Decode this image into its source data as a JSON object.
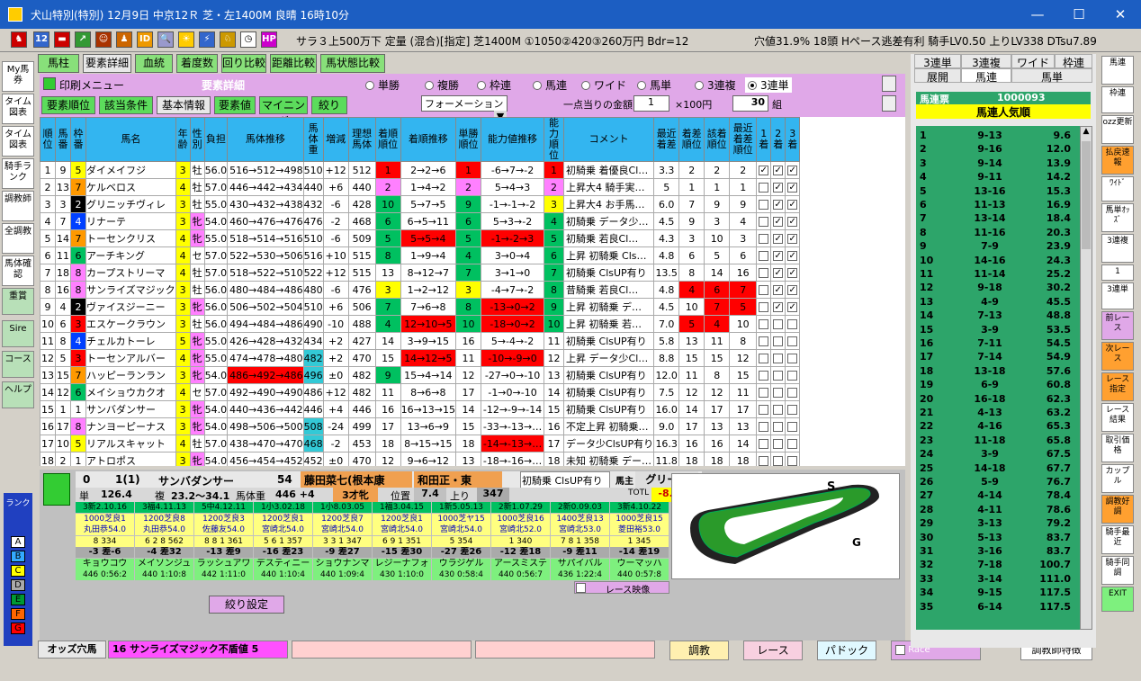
{
  "window": {
    "title": "犬山特別(特別)  12月9日  中京12Ｒ 芝・左1400M 良晴 16時10分",
    "min": "—",
    "max": "☐",
    "close": "✕"
  },
  "race_info": "サラ３上500万下 定量 (混合)[指定] 芝1400M ①1050②420③260万円 Bdr=12",
  "race_right": "穴値31.9% 18頭 Hペース逃差有利 騎手LV0.50 上りLV338 DTsu7.89",
  "left_nav": [
    "My馬券",
    "タイム図表",
    "タイム図表",
    "騎手ランク",
    "調教師",
    "全調教",
    "馬体確認",
    "重賞",
    "Sire",
    "コース",
    "ヘルプ"
  ],
  "rank": {
    "label": "ランク",
    "items": [
      "A",
      "B",
      "C",
      "D",
      "E",
      "F",
      "G"
    ]
  },
  "tabs": [
    "馬柱",
    "要素詳細",
    "血統",
    "着度数",
    "回り比較",
    "距離比較",
    "馬状態比較"
  ],
  "panel": {
    "print": "印刷メニュー",
    "title": "要素詳細",
    "btns": [
      "要素順位",
      "該当条件",
      "基本情報",
      "要素値",
      "マイニング",
      "絞り"
    ],
    "radios": [
      "単勝",
      "複勝",
      "枠連",
      "馬連",
      "ワイド",
      "馬単",
      "3連複",
      "3連単"
    ],
    "radio_selected": 7,
    "mode": "フォーメーション",
    "amount_label": "一点当りの金額",
    "amount": "1",
    "unit": "×100円",
    "count": "30",
    "count_unit": "組"
  },
  "headers": [
    "順位",
    "馬番",
    "枠番",
    "馬名",
    "年齢",
    "性別",
    "負担",
    "馬体推移",
    "馬体重",
    "増減",
    "理想馬体",
    "着順順位",
    "着順推移",
    "単勝順位",
    "能力値推移",
    "能力順位",
    "コメント",
    "最近着差",
    "着差順位",
    "該着順位",
    "最近着差順位",
    "1着",
    "2着",
    "3着"
  ],
  "rows": [
    [
      "1",
      "9",
      "5",
      "ダイメイフジ",
      "3",
      "牡",
      "56.0",
      "516→512→498",
      "510",
      "+12",
      "512",
      "1",
      "2→2→6",
      "1",
      "-6→7→-2",
      "1",
      "初騎乗 着優良Cl…",
      "3.3",
      "2",
      "2",
      "2",
      "✓",
      "✓",
      "✓"
    ],
    [
      "2",
      "13",
      "7",
      "ケルベロス",
      "4",
      "牡",
      "57.0",
      "446→442→434",
      "440",
      "+6",
      "440",
      "2",
      "1→4→2",
      "2",
      "5→4→3",
      "2",
      "上昇大4 騎手実…",
      "5",
      "1",
      "1",
      "1",
      "",
      "✓",
      "✓"
    ],
    [
      "3",
      "3",
      "2",
      "グリニッチヴィレ",
      "3",
      "牡",
      "55.0",
      "430→432→438",
      "432",
      "-6",
      "428",
      "10",
      "5→7→5",
      "9",
      "-1→-1→-2",
      "3",
      "上昇大4 お手馬…",
      "6.0",
      "7",
      "9",
      "9",
      "",
      "✓",
      "✓"
    ],
    [
      "4",
      "7",
      "4",
      "リナーテ",
      "3",
      "牝",
      "54.0",
      "460→476→476",
      "476",
      "-2",
      "468",
      "6",
      "6→5→11",
      "6",
      "5→3→-2",
      "4",
      "初騎乗 データ少…",
      "4.5",
      "9",
      "3",
      "4",
      "",
      "✓",
      "✓"
    ],
    [
      "5",
      "14",
      "7",
      "トーセンクリス",
      "4",
      "牝",
      "55.0",
      "518→514→516",
      "510",
      "-6",
      "509",
      "5",
      "5→5→4",
      "5",
      "-1→-2→3",
      "5",
      "初騎乗 若良Cl…",
      "4.3",
      "3",
      "10",
      "3",
      "",
      "✓",
      "✓"
    ],
    [
      "6",
      "11",
      "6",
      "アーチキング",
      "4",
      "セ",
      "57.0",
      "522→530→506",
      "516",
      "+10",
      "515",
      "8",
      "1→9→4",
      "4",
      "3→0→4",
      "6",
      "上昇 初騎乗 Cls…",
      "4.8",
      "6",
      "5",
      "6",
      "",
      "✓",
      "✓"
    ],
    [
      "7",
      "18",
      "8",
      "カープストリーマ",
      "4",
      "牡",
      "57.0",
      "518→522→510",
      "522",
      "+12",
      "515",
      "13",
      "8→12→7",
      "7",
      "3→1→0",
      "7",
      "初騎乗 ClsUP有り",
      "13.5",
      "8",
      "14",
      "16",
      "",
      "✓",
      "✓"
    ],
    [
      "8",
      "16",
      "8",
      "サンライズマジック",
      "3",
      "牡",
      "56.0",
      "480→484→486",
      "480",
      "-6",
      "476",
      "3",
      "1→2→12",
      "3",
      "-4→7→-2",
      "8",
      "昔騎乗 若良Cl…",
      "4.8",
      "4",
      "6",
      "7",
      "",
      "✓",
      "✓"
    ],
    [
      "9",
      "4",
      "2",
      "ヴァイスジーニー",
      "3",
      "牝",
      "56.0",
      "506→502→504",
      "510",
      "+6",
      "506",
      "7",
      "7→6→8",
      "8",
      "-13→0→2",
      "9",
      "上昇 初騎乗 デ…",
      "4.5",
      "10",
      "7",
      "5",
      "",
      "✓",
      "✓"
    ],
    [
      "10",
      "6",
      "3",
      "エスケークラウン",
      "3",
      "牡",
      "56.0",
      "494→484→486",
      "490",
      "-10",
      "488",
      "4",
      "12→10→5",
      "10",
      "-18→0→2",
      "10",
      "上昇 初騎乗 若…",
      "7.0",
      "5",
      "4",
      "10",
      "",
      "",
      ""
    ],
    [
      "11",
      "8",
      "4",
      "チェルカトーレ",
      "5",
      "牝",
      "55.0",
      "426→428→432",
      "434",
      "+2",
      "427",
      "14",
      "3→9→15",
      "16",
      "5→-4→-2",
      "11",
      "初騎乗 ClsUP有り",
      "5.8",
      "13",
      "11",
      "8",
      "",
      "",
      ""
    ],
    [
      "12",
      "5",
      "3",
      "トーセンアルバー",
      "4",
      "牝",
      "55.0",
      "474→478→480",
      "482",
      "+2",
      "470",
      "15",
      "14→12→5",
      "11",
      "-10→-9→0",
      "12",
      "上昇 データ少Cl…",
      "8.8",
      "15",
      "15",
      "12",
      "",
      "",
      ""
    ],
    [
      "13",
      "15",
      "7",
      "ハッピーランラン",
      "3",
      "牝",
      "54.0",
      "486→492→486",
      "496",
      "±0",
      "482",
      "9",
      "15→4→14",
      "12",
      "-27→0→-10",
      "13",
      "初騎乗 ClsUP有り",
      "12.0",
      "11",
      "8",
      "15",
      "",
      "",
      ""
    ],
    [
      "14",
      "12",
      "6",
      "メイショウカクオ",
      "4",
      "セ",
      "57.0",
      "492→490→490",
      "486",
      "+12",
      "482",
      "11",
      "8→6→8",
      "17",
      "-1→0→-10",
      "14",
      "初騎乗 ClsUP有り",
      "7.5",
      "12",
      "12",
      "11",
      "",
      "",
      ""
    ],
    [
      "15",
      "1",
      "1",
      "サンバダンサー",
      "3",
      "牝",
      "54.0",
      "440→436→442",
      "446",
      "+4",
      "446",
      "16",
      "16→13→15",
      "14",
      "-12→-9→-14",
      "15",
      "初騎乗 ClsUP有り",
      "16.0",
      "14",
      "17",
      "17",
      "",
      "",
      ""
    ],
    [
      "16",
      "17",
      "8",
      "ナンヨーピーナス",
      "3",
      "牝",
      "54.0",
      "498→506→500",
      "508",
      "-24",
      "499",
      "17",
      "13→6→9",
      "15",
      "-33→-13→…",
      "16",
      "不定上昇 初騎乗…",
      "9.0",
      "17",
      "13",
      "13",
      "",
      "",
      ""
    ],
    [
      "17",
      "10",
      "5",
      "リアルスキャット",
      "4",
      "牡",
      "57.0",
      "438→470→470",
      "468",
      "-2",
      "453",
      "18",
      "8→15→15",
      "18",
      "-14→-13→…",
      "17",
      "データ少ClsUP有り",
      "16.3",
      "16",
      "16",
      "14",
      "",
      "",
      ""
    ],
    [
      "18",
      "2",
      "1",
      "アトロポス",
      "3",
      "牝",
      "54.0",
      "456→454→452",
      "452",
      "±0",
      "470",
      "12",
      "9→6→12",
      "13",
      "-18→-16→…",
      "18",
      "未知 初騎乗 デー…",
      "11.8",
      "18",
      "18",
      "18",
      "",
      "",
      ""
    ]
  ],
  "detail": {
    "num": "0",
    "waku": "1(1)",
    "name": "サンバダンサー",
    "weight": "54",
    "jockey": "藤田菜七(根本康",
    "trainer": "和田正・東",
    "comment": "初騎乗 ClsUP有り",
    "owner_lbl": "馬主",
    "owner": "グリーン",
    "tan_lbl": "単",
    "tan": "126.4",
    "fuku_lbl": "複",
    "fuku": "23.2～34.1",
    "bw_lbl": "馬体重",
    "bw": "446 +4",
    "age": "3才牝",
    "pos_lbl": "位置",
    "pos": "7.4",
    "agari_lbl": "上り",
    "agari": "347",
    "totl_lbl": "TOTL",
    "totl": "-8.6 O",
    "past": [
      {
        "d": "3新2.10.16",
        "c": "1000芝良1",
        "j": "丸田恭54.0",
        "n": "8 334",
        "s": "-3 差-6",
        "h": "キョウコウ",
        "t": "446 0:56:2"
      },
      {
        "d": "3福4.11.13",
        "c": "1200芝良8",
        "j": "丸田恭54.0",
        "n": "6 2 8 562",
        "s": "-4 差32",
        "h": "メイソンジュ",
        "t": "440 1:10:8"
      },
      {
        "d": "5中4.12.11",
        "c": "1200芝良3",
        "j": "佐藤友54.0",
        "n": "8 8 1 361",
        "s": "-13 差9",
        "h": "ラッシュアワ",
        "t": "442 1:11:0"
      },
      {
        "d": "1小3.02.18",
        "c": "1200芝良1",
        "j": "宮崎北54.0",
        "n": "5 6 1 357",
        "s": "-16 差23",
        "h": "デスティニー",
        "t": "440 1:10:4"
      },
      {
        "d": "1小8.03.05",
        "c": "1200芝良7",
        "j": "宮崎北54.0",
        "n": "3 3 1 347",
        "s": "-9 差27",
        "h": "ショウナンマ",
        "t": "440 1:09:4"
      },
      {
        "d": "1福3.04.15",
        "c": "1200芝良1",
        "j": "宮崎北54.0",
        "n": "6 9 1 351",
        "s": "-15 差30",
        "h": "レジーナフォ",
        "t": "430 1:10:0"
      },
      {
        "d": "1新5.05.13",
        "c": "1000芝ヤ15",
        "j": "宮崎北54.0",
        "n": "5 354",
        "s": "-27 差26",
        "h": "ウラジゲル",
        "t": "430 0:58:4"
      },
      {
        "d": "2新1.07.29",
        "c": "1000芝良16",
        "j": "宮崎北52.0",
        "n": "1 340",
        "s": "-12 差18",
        "h": "アースミステ",
        "t": "440 0:56:7"
      },
      {
        "d": "2新0.09.03",
        "c": "1400芝良13",
        "j": "宮崎北53.0",
        "n": "7 8 1 358",
        "s": "-9 差11",
        "h": "サパイバル",
        "t": "436 1:22:4"
      },
      {
        "d": "3新4.10.22",
        "c": "1000芝良15",
        "j": "菱田裕53.0",
        "n": "1 345",
        "s": "-14 差19",
        "h": "ウーマッハ",
        "t": "440 0:57:8"
      }
    ],
    "filter_btn": "絞り設定",
    "video": "レース映像"
  },
  "course": {
    "start": "S",
    "goal": "G"
  },
  "bottom": {
    "odds_lbl": "オッズ穴馬",
    "odds_val": "16 サンライズマジック不盾値 5",
    "btn1": "調教",
    "btn2": "レース",
    "btn3": "パドック",
    "race_chk": "Race",
    "btn4": "調教師特徴"
  },
  "right_tabs": [
    "3連単",
    "3連複",
    "ワイド",
    "枠連",
    "展開",
    "馬連",
    "馬単"
  ],
  "right_title": "馬連票",
  "right_id": "1000093",
  "right_head": "馬連人気順",
  "right_rows": [
    [
      "1",
      "9-13",
      "9.6"
    ],
    [
      "2",
      "9-16",
      "12.0"
    ],
    [
      "3",
      "9-14",
      "13.9"
    ],
    [
      "4",
      "9-11",
      "14.2"
    ],
    [
      "5",
      "13-16",
      "15.3"
    ],
    [
      "6",
      "11-13",
      "16.9"
    ],
    [
      "7",
      "13-14",
      "18.4"
    ],
    [
      "8",
      "11-16",
      "20.3"
    ],
    [
      "9",
      "7-9",
      "23.9"
    ],
    [
      "10",
      "14-16",
      "24.3"
    ],
    [
      "11",
      "11-14",
      "25.2"
    ],
    [
      "12",
      "9-18",
      "30.2"
    ],
    [
      "13",
      "4-9",
      "45.5"
    ],
    [
      "14",
      "7-13",
      "48.8"
    ],
    [
      "15",
      "3-9",
      "53.5"
    ],
    [
      "16",
      "7-11",
      "54.5"
    ],
    [
      "17",
      "7-14",
      "54.9"
    ],
    [
      "18",
      "13-18",
      "57.6"
    ],
    [
      "19",
      "6-9",
      "60.8"
    ],
    [
      "20",
      "16-18",
      "62.3"
    ],
    [
      "21",
      "4-13",
      "63.2"
    ],
    [
      "22",
      "4-16",
      "65.3"
    ],
    [
      "23",
      "11-18",
      "65.8"
    ],
    [
      "24",
      "3-9",
      "67.5"
    ],
    [
      "25",
      "14-18",
      "67.7"
    ],
    [
      "26",
      "5-9",
      "76.7"
    ],
    [
      "27",
      "4-14",
      "78.4"
    ],
    [
      "28",
      "4-11",
      "78.6"
    ],
    [
      "29",
      "3-13",
      "79.2"
    ],
    [
      "30",
      "5-13",
      "83.7"
    ],
    [
      "31",
      "3-16",
      "83.7"
    ],
    [
      "32",
      "7-18",
      "100.7"
    ],
    [
      "33",
      "3-14",
      "111.0"
    ],
    [
      "34",
      "9-15",
      "117.5"
    ],
    [
      "35",
      "6-14",
      "117.5"
    ]
  ],
  "right_nav": [
    "馬連",
    "枠連",
    "ozz更新",
    "払戻速報",
    "ﾜｲﾄﾞ",
    "馬単ｵｯｽﾞ",
    "3連複",
    "1",
    "3連単",
    "前レース",
    "次レース",
    "レース指定",
    "レース結果",
    "取引価格",
    "カップル",
    "調教好調",
    "騎手最近",
    "騎手同調",
    "EXIT"
  ],
  "colors": {
    "title": "#1c5ec2",
    "header": "#33b5f0",
    "green": "#2da56a",
    "pink": "#e0a8e8"
  }
}
